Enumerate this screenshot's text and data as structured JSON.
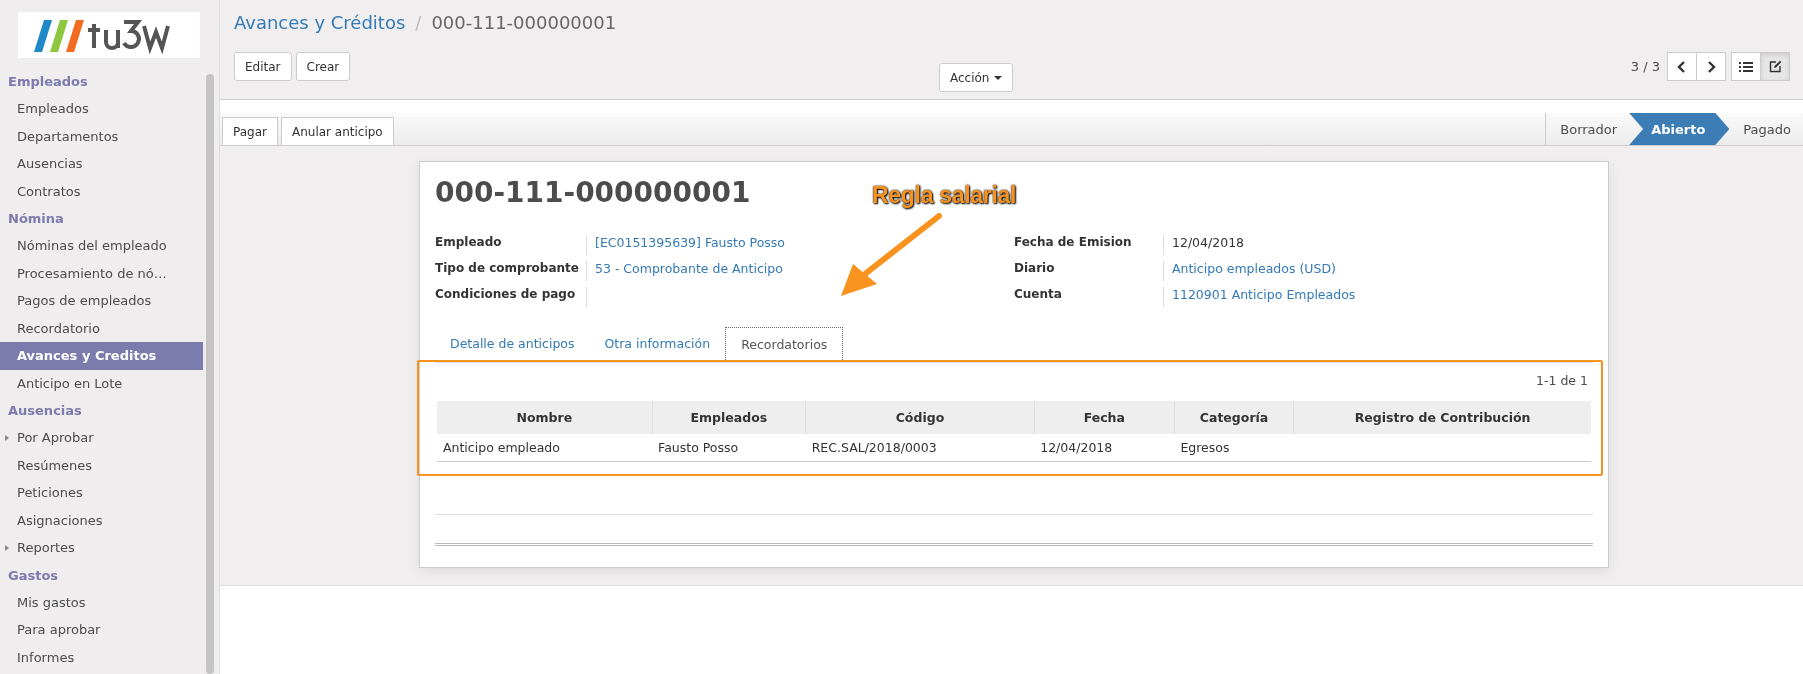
{
  "sidebar": {
    "sections": [
      {
        "title": "Empleados",
        "items": [
          {
            "label": "Empleados",
            "kind": "link",
            "selected": false
          },
          {
            "label": "Departamentos",
            "kind": "link",
            "selected": false
          },
          {
            "label": "Ausencias",
            "kind": "link",
            "selected": false
          },
          {
            "label": "Contratos",
            "kind": "link",
            "selected": false
          }
        ]
      },
      {
        "title": "Nómina",
        "items": [
          {
            "label": "Nóminas del empleado",
            "kind": "link",
            "selected": false
          },
          {
            "label": "Procesamiento de nó…",
            "kind": "link",
            "selected": false
          },
          {
            "label": "Pagos de empleados",
            "kind": "link",
            "selected": false
          },
          {
            "label": "Recordatorio",
            "kind": "link",
            "selected": false
          },
          {
            "label": "Avances y Creditos",
            "kind": "link",
            "selected": true
          },
          {
            "label": "Anticipo en Lote",
            "kind": "link",
            "selected": false
          }
        ]
      },
      {
        "title": "Ausencias",
        "items": [
          {
            "label": "Por Aprobar",
            "kind": "folder",
            "selected": false
          },
          {
            "label": "Resúmenes",
            "kind": "link",
            "selected": false
          },
          {
            "label": "Peticiones",
            "kind": "link",
            "selected": false
          },
          {
            "label": "Asignaciones",
            "kind": "link",
            "selected": false
          },
          {
            "label": "Reportes",
            "kind": "folder",
            "selected": false
          }
        ]
      },
      {
        "title": "Gastos",
        "items": [
          {
            "label": "Mis gastos",
            "kind": "link",
            "selected": false
          },
          {
            "label": "Para aprobar",
            "kind": "link",
            "selected": false
          },
          {
            "label": "Informes",
            "kind": "link",
            "selected": false
          }
        ]
      }
    ]
  },
  "breadcrumb": {
    "parent": "Avances y Créditos",
    "separator": "/",
    "current": "000-111-000000001"
  },
  "buttons": [
    "Editar",
    "Crear"
  ],
  "action_menu": "Acción",
  "pager": {
    "text": "3 / 3"
  },
  "views": [
    {
      "kind": "list",
      "selected": false
    },
    {
      "kind": "form",
      "selected": true
    }
  ],
  "header_buttons": [
    "Pagar",
    "Anular anticipo"
  ],
  "status_steps": [
    {
      "label": "Borrador",
      "selected": false
    },
    {
      "label": "Abierto",
      "selected": true
    },
    {
      "label": "Pagado",
      "selected": false
    }
  ],
  "form": {
    "title": "000-111-000000001",
    "left_fields": [
      {
        "label": "Empleado",
        "value": "[EC0151395639] Fausto Posso",
        "kind": "link"
      },
      {
        "label": "Tipo de comprobante",
        "value": "53 - Comprobante de Anticipo",
        "kind": "link"
      },
      {
        "label": "Condiciones de pago",
        "kind": "empty"
      }
    ],
    "right_fields": [
      {
        "label": "Fecha de Emision",
        "value": "12/04/2018",
        "kind": "text"
      },
      {
        "label": "Diario",
        "value": "Anticipo empleados (USD)",
        "kind": "link"
      },
      {
        "label": "Cuenta",
        "value": "1120901 Anticipo Empleados",
        "kind": "link"
      }
    ],
    "tabs": [
      {
        "label": "Detalle de anticipos",
        "selected": false
      },
      {
        "label": "Otra información",
        "selected": false
      },
      {
        "label": "Recordatorios",
        "selected": true
      }
    ],
    "table": {
      "pager": "1-1 de 1",
      "columns": [
        "Nombre",
        "Empleados",
        "Código",
        "Fecha",
        "Categoría",
        "Registro de Contribución"
      ],
      "rows": [
        [
          "Anticipo empleado",
          "Fausto Posso",
          "REC.SAL/2018/0003",
          "12/04/2018",
          "Egresos",
          ""
        ]
      ]
    }
  },
  "annotation": {
    "label": "Regla salarial"
  }
}
